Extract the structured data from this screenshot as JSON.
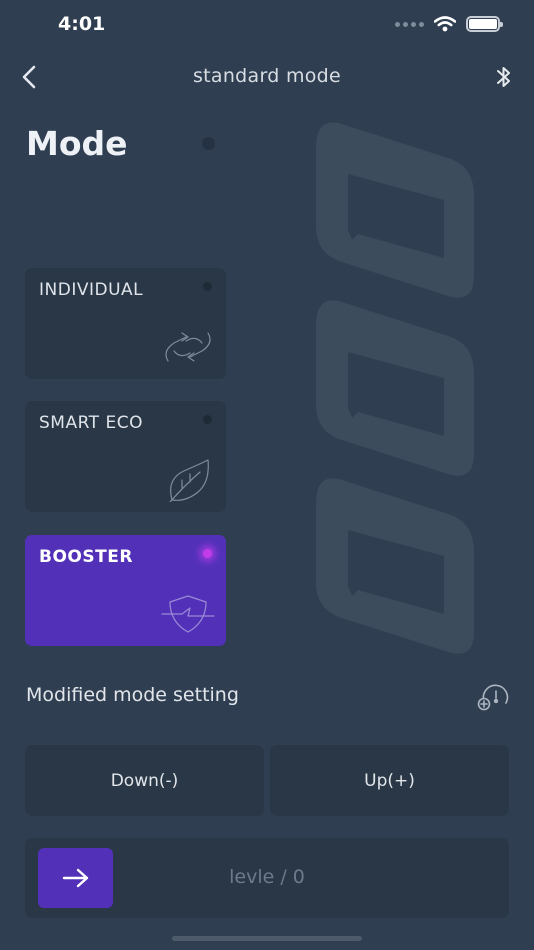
{
  "status_bar": {
    "time": "4:01"
  },
  "nav": {
    "title": "standard mode"
  },
  "page": {
    "title": "Mode"
  },
  "modes": [
    {
      "label": "INDIVIDUAL",
      "icon": "link-arrows-icon",
      "active": false
    },
    {
      "label": "SMART ECO",
      "icon": "leaf-icon",
      "active": false
    },
    {
      "label": "BOOSTER",
      "icon": "shield-bolt-icon",
      "active": true
    }
  ],
  "modified": {
    "label": "Modified mode setting",
    "icon": "speedometer-add-icon"
  },
  "controls": {
    "down_label": "Down(-)",
    "up_label": "Up(+)"
  },
  "level": {
    "text": "levle / 0"
  },
  "colors": {
    "background": "#2f3e50",
    "card": "#2a3746",
    "accent": "#5231b8",
    "active_dot": "#c23ce8"
  }
}
